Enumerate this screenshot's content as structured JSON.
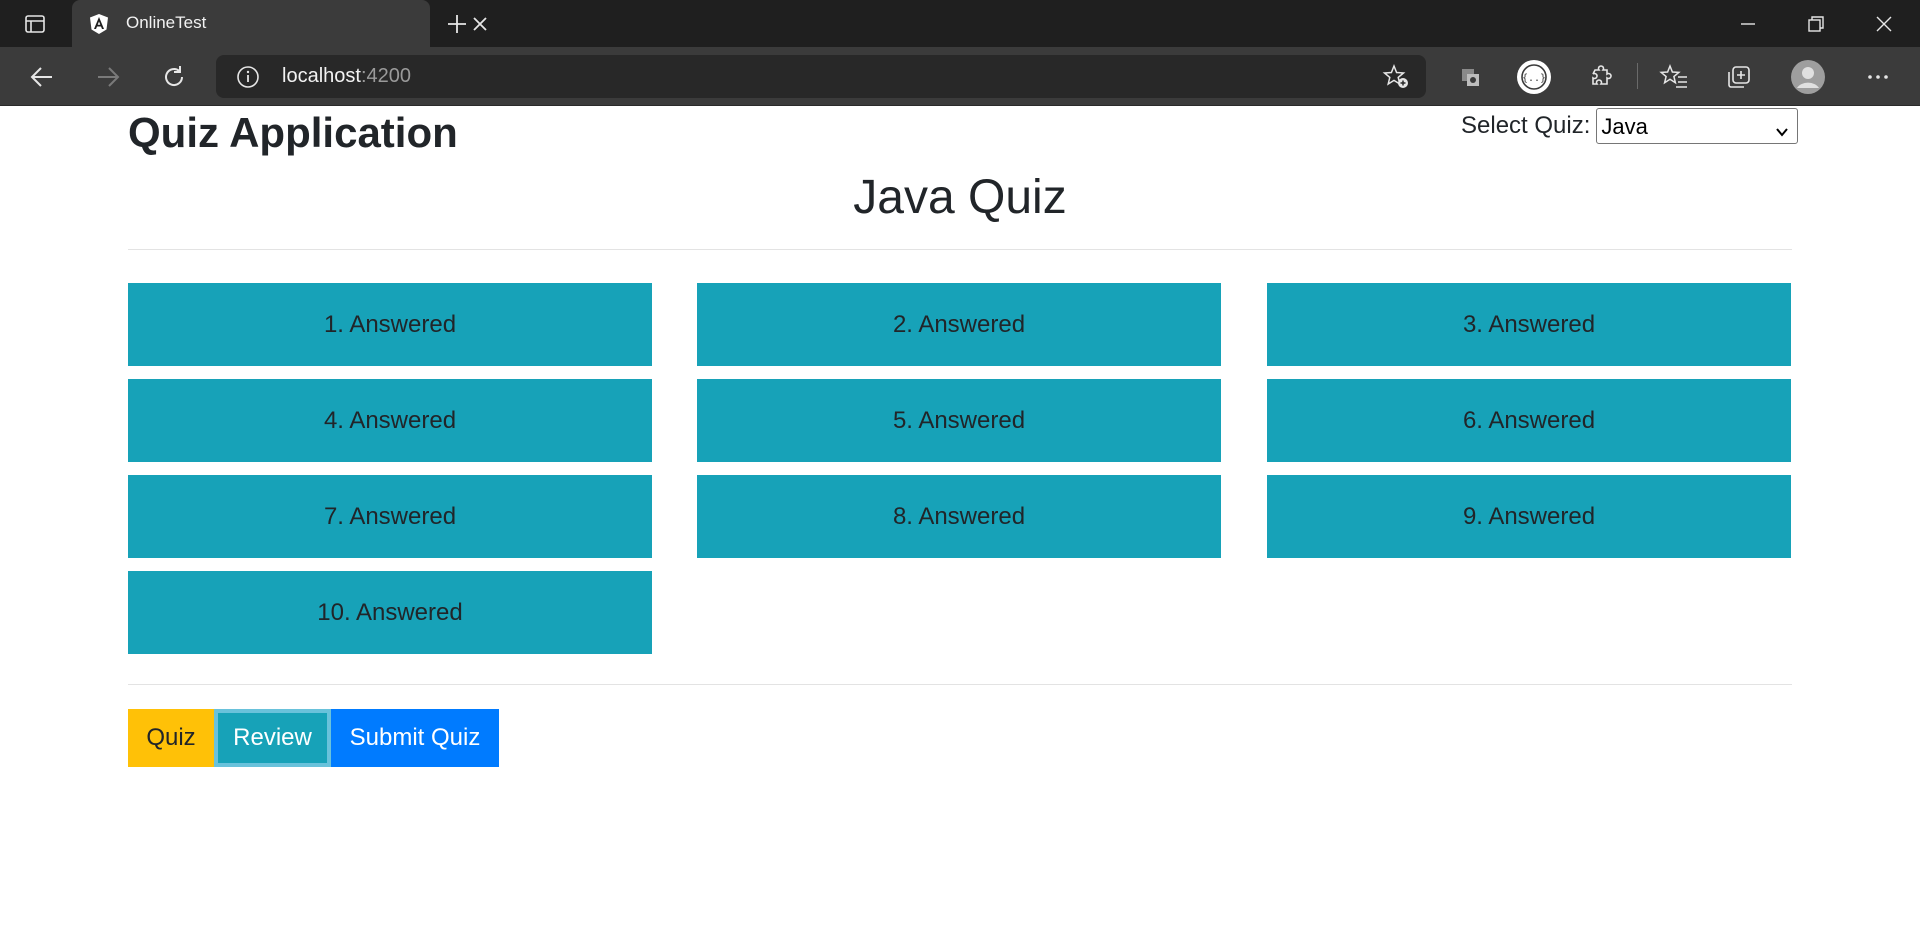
{
  "browser": {
    "tab_title": "OnlineTest",
    "url_host": "localhost",
    "url_port": ":4200"
  },
  "header": {
    "app_title": "Quiz Application",
    "select_label": "Select Quiz:",
    "selected_quiz": "Java"
  },
  "quiz": {
    "title": "Java Quiz",
    "questions": [
      "1. Answered",
      "2. Answered",
      "3. Answered",
      "4. Answered",
      "5. Answered",
      "6. Answered",
      "7. Answered",
      "8. Answered",
      "9. Answered",
      "10. Answered"
    ]
  },
  "buttons": {
    "quiz": "Quiz",
    "review": "Review",
    "submit": "Submit Quiz"
  },
  "colors": {
    "tile": "#17a2b8",
    "quiz_button": "#ffc107",
    "review_button": "#17a2b8",
    "submit_button": "#007bff"
  }
}
